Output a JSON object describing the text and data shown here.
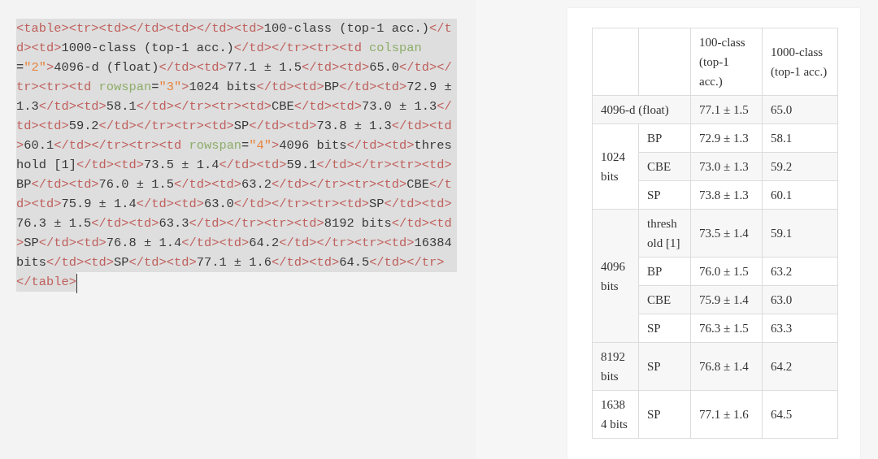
{
  "editor": {
    "lines": [
      {
        "tokens": [
          {
            "kind": "tag",
            "text": "<table><tr><td></td><td></td><td>"
          },
          {
            "kind": "text",
            "text": "100-class (top-1 acc.)"
          },
          {
            "kind": "tag",
            "text": "</t"
          }
        ]
      },
      {
        "tokens": [
          {
            "kind": "tag",
            "text": "d><td>"
          },
          {
            "kind": "text",
            "text": "1000-class (top-1 acc.)"
          },
          {
            "kind": "tag",
            "text": "</td></tr><tr><td "
          },
          {
            "kind": "attr",
            "text": "colspan"
          }
        ]
      },
      {
        "tokens": [
          {
            "kind": "text",
            "text": "="
          },
          {
            "kind": "value",
            "text": "\"2\""
          },
          {
            "kind": "tag",
            "text": ">"
          },
          {
            "kind": "text",
            "text": "4096-d (float)"
          },
          {
            "kind": "tag",
            "text": "</td><td>"
          },
          {
            "kind": "text",
            "text": "77.1 ± 1.5"
          },
          {
            "kind": "tag",
            "text": "</td><td>"
          },
          {
            "kind": "text",
            "text": "65.0"
          },
          {
            "kind": "tag",
            "text": "</td></"
          }
        ]
      },
      {
        "tokens": [
          {
            "kind": "tag",
            "text": "tr><tr><td "
          },
          {
            "kind": "attr",
            "text": "rowspan"
          },
          {
            "kind": "text",
            "text": "="
          },
          {
            "kind": "value",
            "text": "\"3\""
          },
          {
            "kind": "tag",
            "text": ">"
          },
          {
            "kind": "text",
            "text": "1024 bits"
          },
          {
            "kind": "tag",
            "text": "</td><td>"
          },
          {
            "kind": "text",
            "text": "BP"
          },
          {
            "kind": "tag",
            "text": "</td><td>"
          },
          {
            "kind": "text",
            "text": "72.9 ±"
          }
        ]
      },
      {
        "tokens": [
          {
            "kind": "text",
            "text": "1.3"
          },
          {
            "kind": "tag",
            "text": "</td><td>"
          },
          {
            "kind": "text",
            "text": "58.1"
          },
          {
            "kind": "tag",
            "text": "</td></tr><tr><td>"
          },
          {
            "kind": "text",
            "text": "CBE"
          },
          {
            "kind": "tag",
            "text": "</td><td>"
          },
          {
            "kind": "text",
            "text": "73.0 ± 1.3"
          },
          {
            "kind": "tag",
            "text": "</"
          }
        ]
      },
      {
        "tokens": [
          {
            "kind": "tag",
            "text": "td><td>"
          },
          {
            "kind": "text",
            "text": "59.2"
          },
          {
            "kind": "tag",
            "text": "</td></tr><tr><td>"
          },
          {
            "kind": "text",
            "text": "SP"
          },
          {
            "kind": "tag",
            "text": "</td><td>"
          },
          {
            "kind": "text",
            "text": "73.8 ± 1.3"
          },
          {
            "kind": "tag",
            "text": "</td><td"
          }
        ]
      },
      {
        "tokens": [
          {
            "kind": "tag",
            "text": ">"
          },
          {
            "kind": "text",
            "text": "60.1"
          },
          {
            "kind": "tag",
            "text": "</td></tr><tr><td "
          },
          {
            "kind": "attr",
            "text": "rowspan"
          },
          {
            "kind": "text",
            "text": "="
          },
          {
            "kind": "value",
            "text": "\"4\""
          },
          {
            "kind": "tag",
            "text": ">"
          },
          {
            "kind": "text",
            "text": "4096 bits"
          },
          {
            "kind": "tag",
            "text": "</td><td>"
          },
          {
            "kind": "text",
            "text": "thres"
          }
        ]
      },
      {
        "tokens": [
          {
            "kind": "text",
            "text": "hold [1]"
          },
          {
            "kind": "tag",
            "text": "</td><td>"
          },
          {
            "kind": "text",
            "text": "73.5 ± 1.4"
          },
          {
            "kind": "tag",
            "text": "</td><td>"
          },
          {
            "kind": "text",
            "text": "59.1"
          },
          {
            "kind": "tag",
            "text": "</td></tr><tr><td>"
          }
        ]
      },
      {
        "tokens": [
          {
            "kind": "text",
            "text": "BP"
          },
          {
            "kind": "tag",
            "text": "</td><td>"
          },
          {
            "kind": "text",
            "text": "76.0 ± 1.5"
          },
          {
            "kind": "tag",
            "text": "</td><td>"
          },
          {
            "kind": "text",
            "text": "63.2"
          },
          {
            "kind": "tag",
            "text": "</td></tr><tr><td>"
          },
          {
            "kind": "text",
            "text": "CBE"
          },
          {
            "kind": "tag",
            "text": "</t"
          }
        ]
      },
      {
        "tokens": [
          {
            "kind": "tag",
            "text": "d><td>"
          },
          {
            "kind": "text",
            "text": "75.9 ± 1.4"
          },
          {
            "kind": "tag",
            "text": "</td><td>"
          },
          {
            "kind": "text",
            "text": "63.0"
          },
          {
            "kind": "tag",
            "text": "</td></tr><tr><td>"
          },
          {
            "kind": "text",
            "text": "SP"
          },
          {
            "kind": "tag",
            "text": "</td><td>"
          }
        ]
      },
      {
        "tokens": [
          {
            "kind": "text",
            "text": "76.3 ± 1.5"
          },
          {
            "kind": "tag",
            "text": "</td><td>"
          },
          {
            "kind": "text",
            "text": "63.3"
          },
          {
            "kind": "tag",
            "text": "</td></tr><tr><td>"
          },
          {
            "kind": "text",
            "text": "8192 bits"
          },
          {
            "kind": "tag",
            "text": "</td><td"
          }
        ]
      },
      {
        "tokens": [
          {
            "kind": "tag",
            "text": ">"
          },
          {
            "kind": "text",
            "text": "SP"
          },
          {
            "kind": "tag",
            "text": "</td><td>"
          },
          {
            "kind": "text",
            "text": "76.8 ± 1.4"
          },
          {
            "kind": "tag",
            "text": "</td><td>"
          },
          {
            "kind": "text",
            "text": "64.2"
          },
          {
            "kind": "tag",
            "text": "</td></tr><tr><td>"
          },
          {
            "kind": "text",
            "text": "16384"
          }
        ]
      },
      {
        "tokens": [
          {
            "kind": "text",
            "text": "bits"
          },
          {
            "kind": "tag",
            "text": "</td><td>"
          },
          {
            "kind": "text",
            "text": "SP"
          },
          {
            "kind": "tag",
            "text": "</td><td>"
          },
          {
            "kind": "text",
            "text": "77.1 ± 1.6"
          },
          {
            "kind": "tag",
            "text": "</td><td>"
          },
          {
            "kind": "text",
            "text": "64.5"
          },
          {
            "kind": "tag",
            "text": "</td></tr>"
          }
        ]
      },
      {
        "tokens": [
          {
            "kind": "tag",
            "text": "</table>"
          }
        ]
      }
    ]
  },
  "preview": {
    "table": {
      "rows": [
        [
          {
            "kind": "blank"
          },
          {
            "kind": "blank"
          },
          {
            "kind": "head",
            "text": "100-class (top-1 acc.)"
          },
          {
            "kind": "head",
            "text": "1000-class (top-1 acc.)"
          }
        ],
        [
          {
            "kind": "data",
            "text": "4096-d (float)",
            "colspan": 2
          },
          {
            "kind": "data",
            "text": "77.1 ± 1.5"
          },
          {
            "kind": "data",
            "text": "65.0"
          }
        ],
        [
          {
            "kind": "data",
            "text": "1024 bits",
            "rowspan": 3
          },
          {
            "kind": "data",
            "text": "BP"
          },
          {
            "kind": "data",
            "text": "72.9 ± 1.3"
          },
          {
            "kind": "data",
            "text": "58.1"
          }
        ],
        [
          {
            "kind": "data",
            "text": "CBE"
          },
          {
            "kind": "data",
            "text": "73.0 ± 1.3"
          },
          {
            "kind": "data",
            "text": "59.2"
          }
        ],
        [
          {
            "kind": "data",
            "text": "SP"
          },
          {
            "kind": "data",
            "text": "73.8 ± 1.3"
          },
          {
            "kind": "data",
            "text": "60.1"
          }
        ],
        [
          {
            "kind": "data",
            "text": "4096 bits",
            "rowspan": 4
          },
          {
            "kind": "data",
            "text": "threshold [1]"
          },
          {
            "kind": "data",
            "text": "73.5 ± 1.4"
          },
          {
            "kind": "data",
            "text": "59.1"
          }
        ],
        [
          {
            "kind": "data",
            "text": "BP"
          },
          {
            "kind": "data",
            "text": "76.0 ± 1.5"
          },
          {
            "kind": "data",
            "text": "63.2"
          }
        ],
        [
          {
            "kind": "data",
            "text": "CBE"
          },
          {
            "kind": "data",
            "text": "75.9 ± 1.4"
          },
          {
            "kind": "data",
            "text": "63.0"
          }
        ],
        [
          {
            "kind": "data",
            "text": "SP"
          },
          {
            "kind": "data",
            "text": "76.3 ± 1.5"
          },
          {
            "kind": "data",
            "text": "63.3"
          }
        ],
        [
          {
            "kind": "data",
            "text": "8192 bits"
          },
          {
            "kind": "data",
            "text": "SP"
          },
          {
            "kind": "data",
            "text": "76.8 ± 1.4"
          },
          {
            "kind": "data",
            "text": "64.2"
          }
        ],
        [
          {
            "kind": "data",
            "text": "16384 bits"
          },
          {
            "kind": "data",
            "text": "SP"
          },
          {
            "kind": "data",
            "text": "77.1 ± 1.6"
          },
          {
            "kind": "data",
            "text": "64.5"
          }
        ]
      ]
    }
  }
}
